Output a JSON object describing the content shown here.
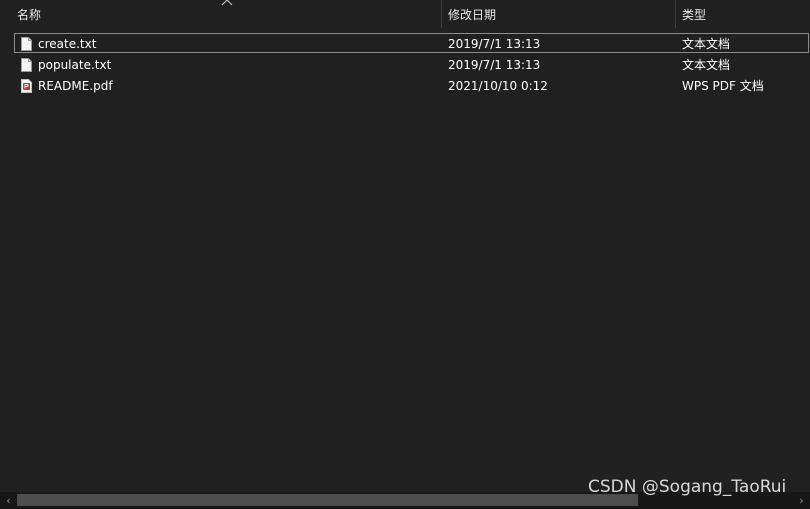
{
  "columns": {
    "name": "名称",
    "date": "修改日期",
    "type": "类型"
  },
  "files": [
    {
      "name": "create.txt",
      "date": "2019/7/1 13:13",
      "type": "文本文档",
      "icon": "text-file-icon"
    },
    {
      "name": "populate.txt",
      "date": "2019/7/1 13:13",
      "type": "文本文档",
      "icon": "text-file-icon"
    },
    {
      "name": "README.pdf",
      "date": "2021/10/10 0:12",
      "type": "WPS PDF 文档",
      "icon": "pdf-file-icon"
    }
  ],
  "scrollbar": {
    "left_arrow": "‹",
    "right_arrow": "›"
  },
  "watermark": "CSDN @Sogang_TaoRui",
  "colors": {
    "background": "#202020",
    "text": "#ffffff",
    "pdf_icon": "#d0312d"
  }
}
